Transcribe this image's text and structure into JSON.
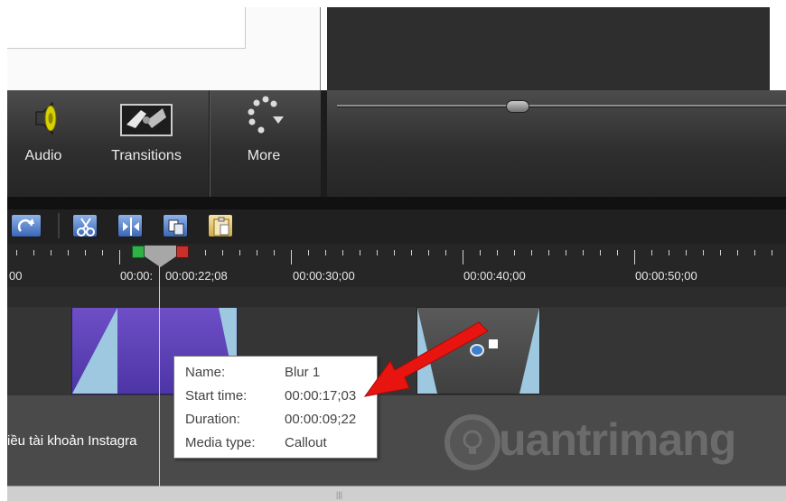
{
  "toolbar": {
    "audio_label": "Audio",
    "transitions_label": "Transitions",
    "more_label": "More"
  },
  "timeline_tools": {
    "icons": [
      "redo-icon",
      "cut-icon",
      "split-icon",
      "copy-icon",
      "paste-icon"
    ]
  },
  "ruler": {
    "labels": [
      "00",
      "00:00:",
      "00:00:22;08",
      "00:00:30;00",
      "00:00:40;00",
      "00:00:50;00"
    ]
  },
  "track2": {
    "label": "iều tài khoản Instagra"
  },
  "tooltip": {
    "name_key": "Name:",
    "name_val": "Blur 1",
    "start_key": "Start time:",
    "start_val": "00:00:17;03",
    "duration_key": "Duration:",
    "duration_val": "00:00:09;22",
    "media_key": "Media type:",
    "media_val": "Callout"
  },
  "watermark": {
    "text": "uantrimang"
  },
  "colors": {
    "arrow": "#e8140f",
    "clip1": "#5b3fb6",
    "playhead_green": "#2fb148",
    "playhead_red": "#c9302c"
  }
}
